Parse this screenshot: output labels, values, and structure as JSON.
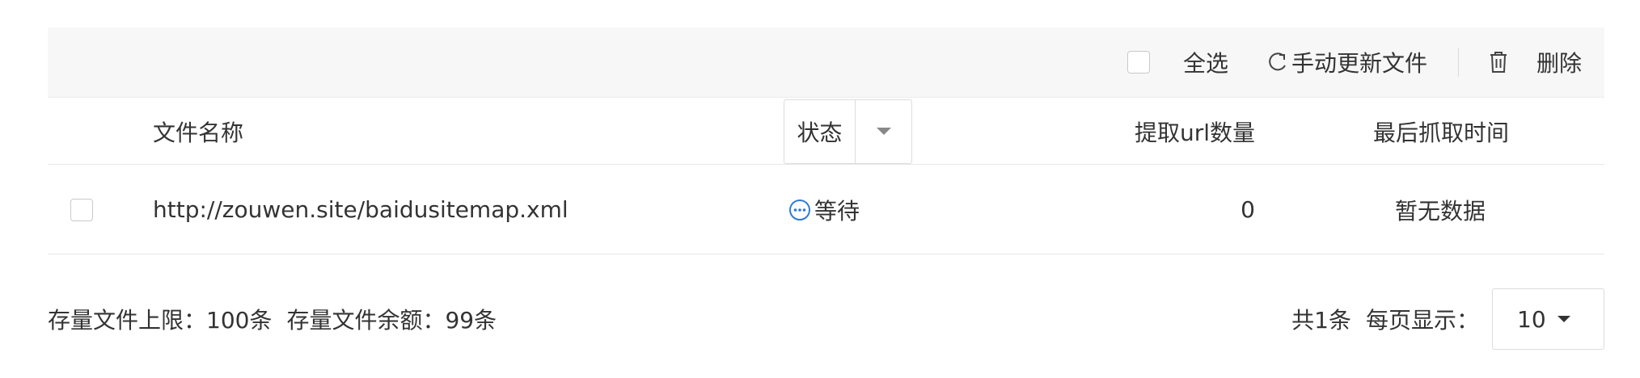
{
  "toolbar": {
    "select_all_label": "全选",
    "refresh_label": "手动更新文件",
    "delete_label": "删除"
  },
  "table": {
    "headers": {
      "name": "文件名称",
      "status": "状态",
      "count": "提取url数量",
      "time": "最后抓取时间"
    },
    "rows": [
      {
        "name": "http://zouwen.site/baidusitemap.xml",
        "status": "等待",
        "count": "0",
        "time": "暂无数据"
      }
    ]
  },
  "footer": {
    "limit_text": "存量文件上限：100条",
    "remaining_text": "存量文件余额：99条",
    "total_text": "共1条",
    "per_page_label": "每页显示：",
    "page_size": "10"
  },
  "colors": {
    "toolbar_bg": "#f7f7f7",
    "status_icon": "#2f7bd6",
    "border": "#e8e8e8"
  }
}
